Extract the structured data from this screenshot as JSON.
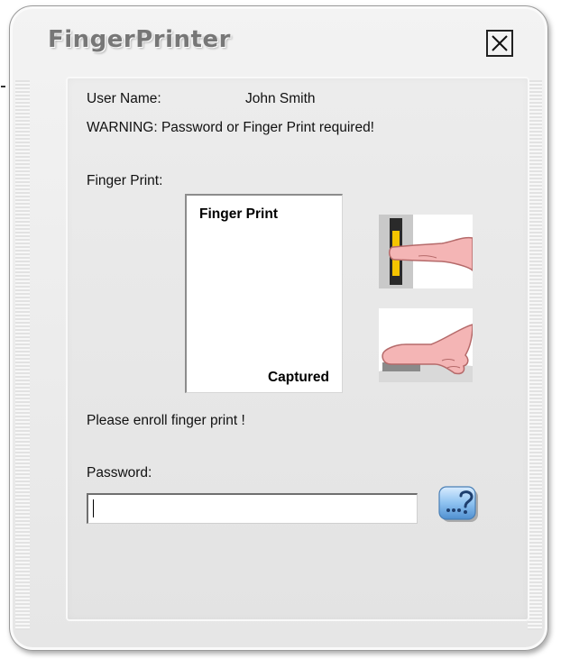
{
  "window": {
    "title": "FingerPrinter",
    "close_icon": "close-icon"
  },
  "user": {
    "label": "User Name:",
    "value": "John Smith"
  },
  "warning": "WARNING: Password or Finger Print required!",
  "fingerprint": {
    "section_label": "Finger Print:",
    "box_title": "Finger Print",
    "status": "Captured",
    "illustrations": [
      "finger-on-scanner-icon",
      "finger-swipe-icon"
    ]
  },
  "enroll_message": "Please enroll finger print !",
  "password": {
    "label": "Password:",
    "value": "",
    "help_icon": "password-help-icon"
  },
  "colors": {
    "title_text": "#777777",
    "scanner_yellow": "#f5c400",
    "finger_pink": "#f4b5b5",
    "help_blue": "#6fa8dc"
  }
}
